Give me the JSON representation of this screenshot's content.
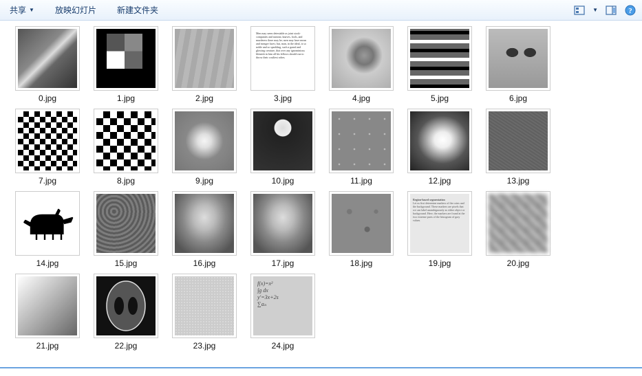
{
  "toolbar": {
    "share_label": "共享",
    "slideshow_label": "放映幻灯片",
    "new_folder_label": "新建文件夹"
  },
  "thumbnails": [
    {
      "label": "0.jpg",
      "kind": "astronaut-photo"
    },
    {
      "label": "1.jpg",
      "kind": "grayscale-squares"
    },
    {
      "label": "2.jpg",
      "kind": "brick-wall"
    },
    {
      "label": "3.jpg",
      "kind": "text-page"
    },
    {
      "label": "4.jpg",
      "kind": "cameraman-photo"
    },
    {
      "label": "5.jpg",
      "kind": "horizontal-gradient-stripes"
    },
    {
      "label": "6.jpg",
      "kind": "cat-face"
    },
    {
      "label": "7.jpg",
      "kind": "checkerboard-fine"
    },
    {
      "label": "8.jpg",
      "kind": "checkerboard-coarse"
    },
    {
      "label": "9.jpg",
      "kind": "blurred-sphere"
    },
    {
      "label": "10.jpg",
      "kind": "teacup"
    },
    {
      "label": "11.jpg",
      "kind": "coins-grid"
    },
    {
      "label": "12.jpg",
      "kind": "radial-blob"
    },
    {
      "label": "13.jpg",
      "kind": "noise-texture"
    },
    {
      "label": "14.jpg",
      "kind": "horse-silhouette"
    },
    {
      "label": "15.jpg",
      "kind": "fingerprint-texture"
    },
    {
      "label": "16.jpg",
      "kind": "lena-hat-photo"
    },
    {
      "label": "17.jpg",
      "kind": "lena-hat-photo"
    },
    {
      "label": "18.jpg",
      "kind": "moon-craters"
    },
    {
      "label": "19.jpg",
      "kind": "book-page-segmentation"
    },
    {
      "label": "20.jpg",
      "kind": "pixel-mosaic"
    },
    {
      "label": "21.jpg",
      "kind": "diagonal-gradient"
    },
    {
      "label": "22.jpg",
      "kind": "alien-face-oval"
    },
    {
      "label": "23.jpg",
      "kind": "stucco-texture"
    },
    {
      "label": "24.jpg",
      "kind": "handwritten-equations"
    }
  ],
  "icons": {
    "view": "view-options-icon",
    "preview": "preview-pane-icon",
    "help": "help-icon"
  }
}
